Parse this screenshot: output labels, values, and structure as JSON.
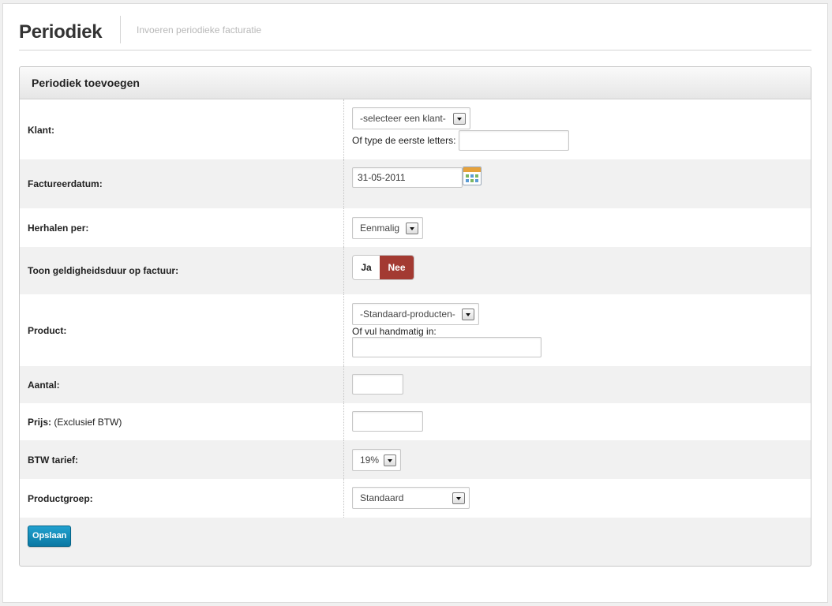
{
  "header": {
    "title": "Periodiek",
    "subtitle": "Invoeren periodieke facturatie"
  },
  "panel": {
    "title": "Periodiek toevoegen"
  },
  "form": {
    "klant": {
      "label": "Klant:",
      "select_value": "-selecteer een klant-",
      "search_label": "Of type de eerste letters:",
      "search_value": ""
    },
    "factuurdatum": {
      "label": "Factureerdatum:",
      "value": "31-05-2011",
      "icon": "calendar-icon"
    },
    "herhalen": {
      "label": "Herhalen per:",
      "select_value": "Eenmalig"
    },
    "geldigheid": {
      "label": "Toon geldigheidsduur op factuur:",
      "option_yes": "Ja",
      "option_no": "Nee",
      "selected": "Nee"
    },
    "product": {
      "label": "Product:",
      "select_value": "-Standaard-producten-",
      "manual_label": "Of vul handmatig in:",
      "manual_value": ""
    },
    "aantal": {
      "label": "Aantal:",
      "value": ""
    },
    "prijs": {
      "label": "Prijs:",
      "note": "(Exclusief BTW)",
      "value": ""
    },
    "btw": {
      "label": "BTW tarief:",
      "select_value": "19%"
    },
    "productgroep": {
      "label": "Productgroep:",
      "select_value": "Standaard"
    }
  },
  "actions": {
    "save_label": "Opslaan"
  },
  "colors": {
    "toggle_active": "#a33a32",
    "save_button": "#1189b8"
  }
}
